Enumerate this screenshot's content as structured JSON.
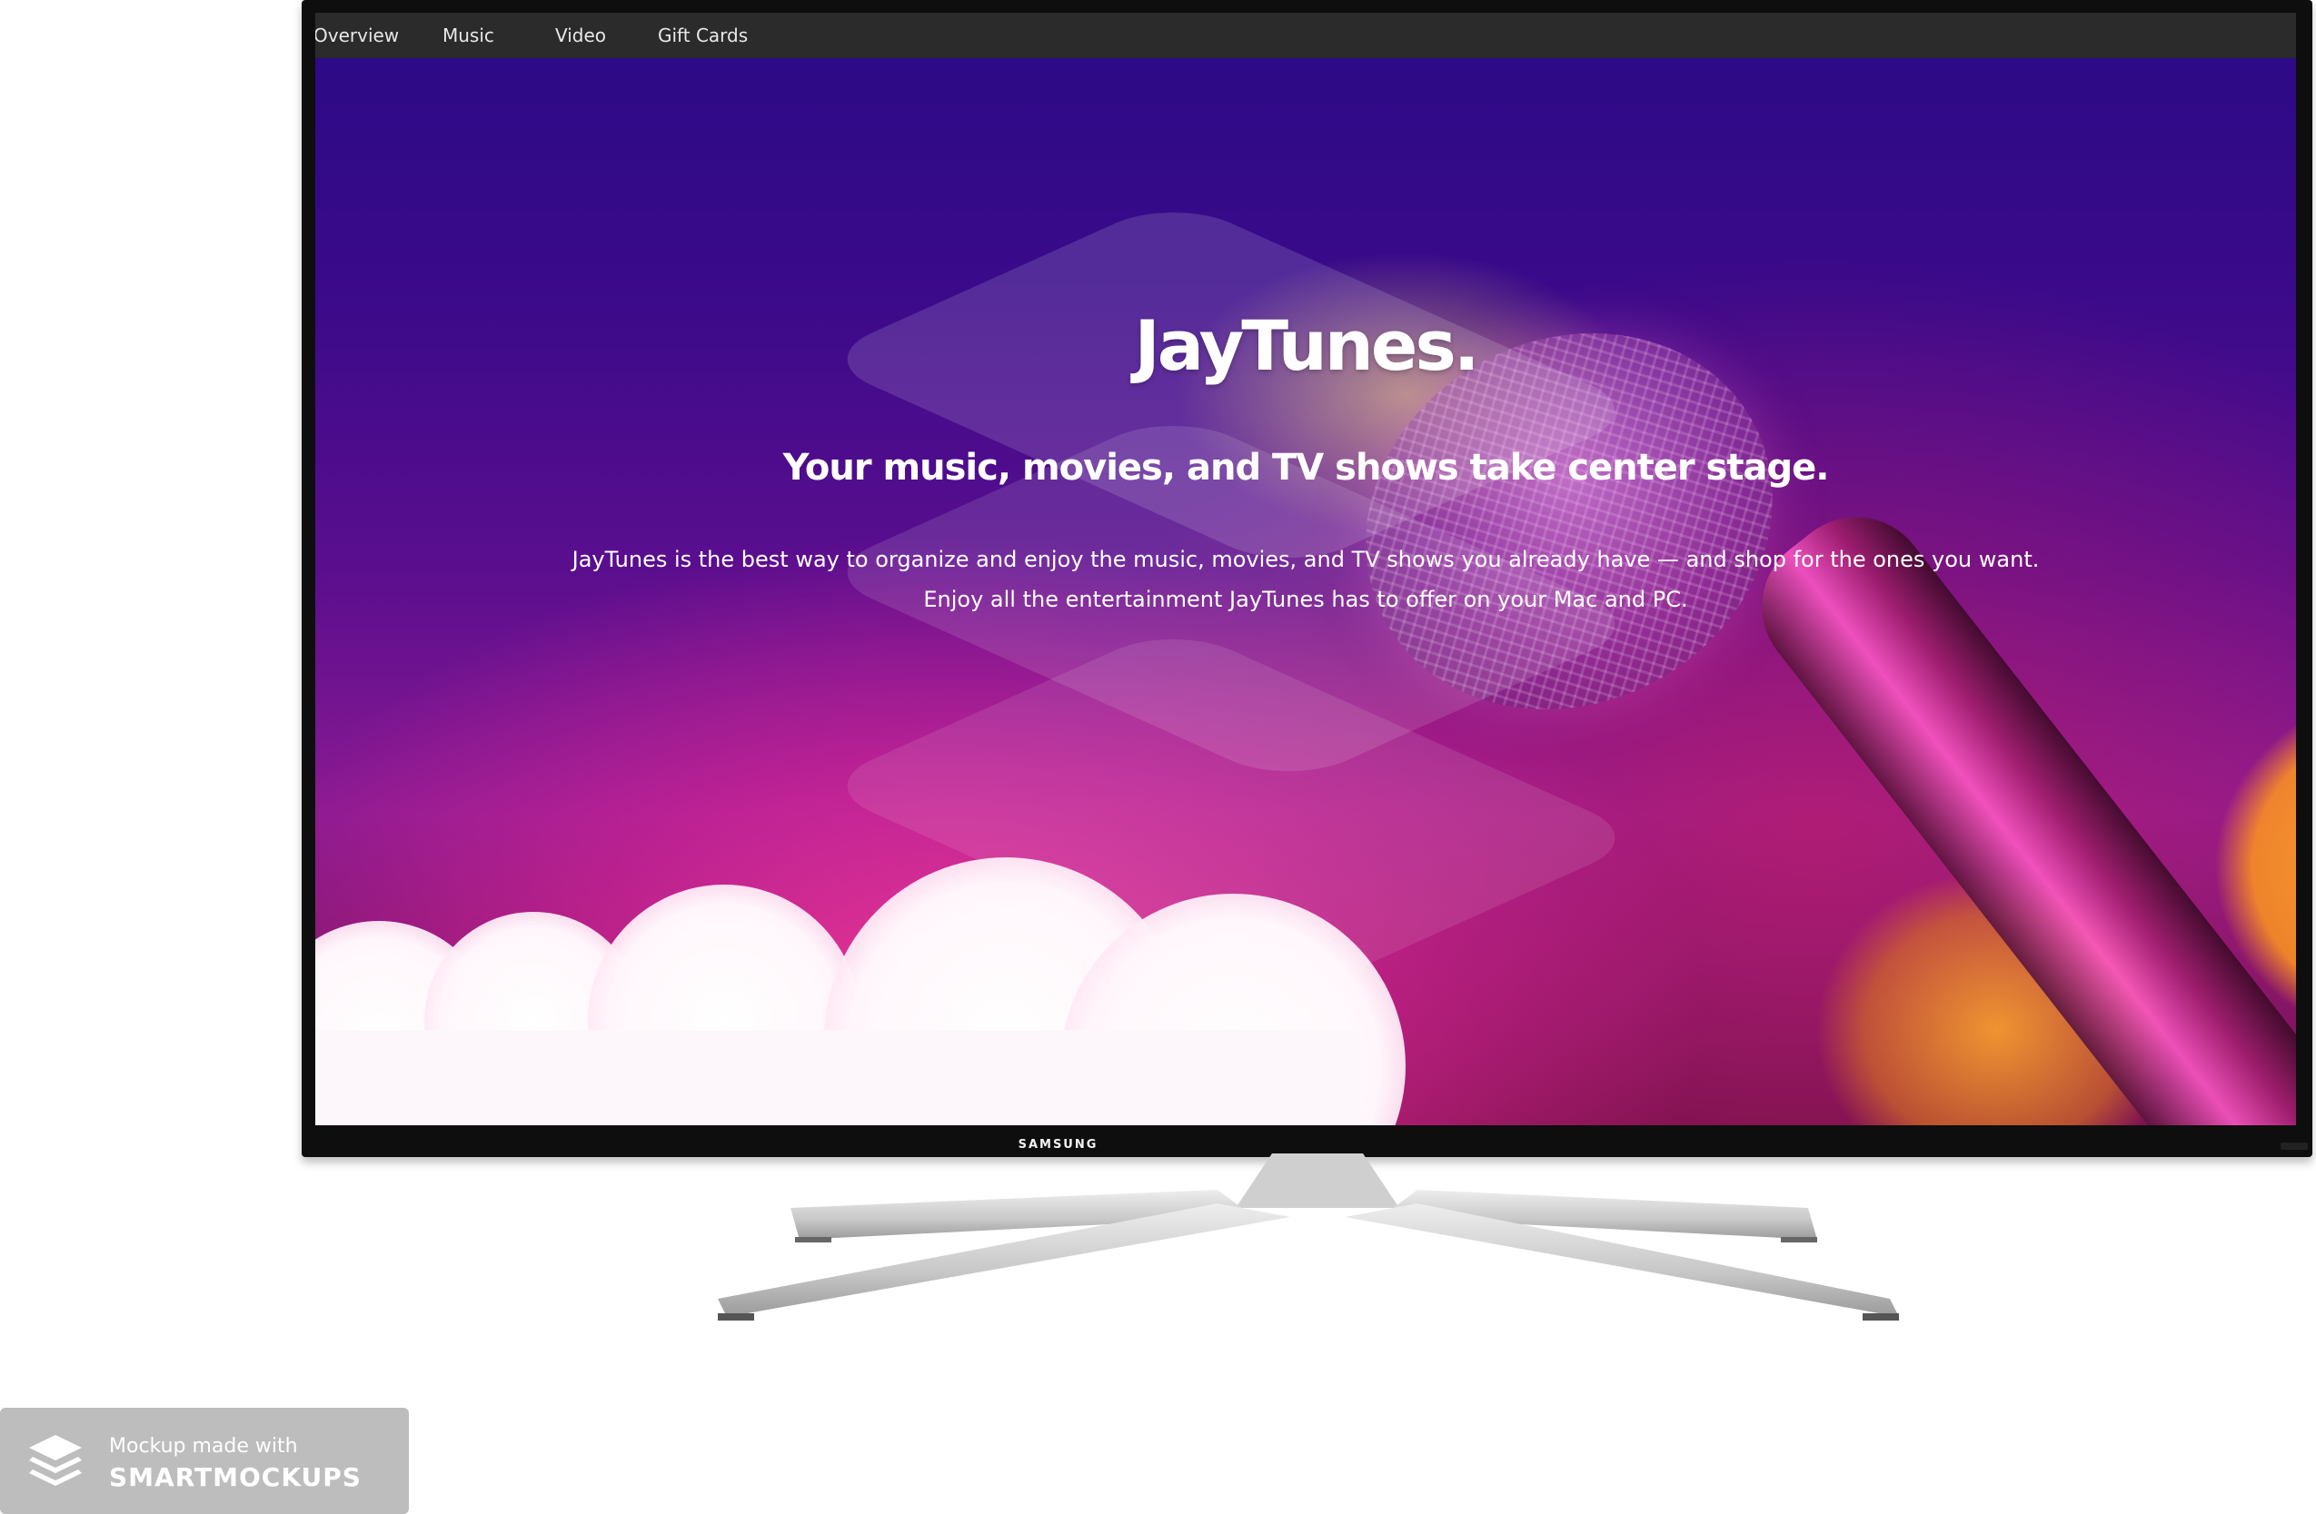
{
  "nav": {
    "items": [
      {
        "label": "Overview"
      },
      {
        "label": "Music"
      },
      {
        "label": "Video"
      },
      {
        "label": "Gift Cards"
      }
    ]
  },
  "hero": {
    "title": "JayTunes.",
    "subtitle": "Your music, movies, and TV shows take center stage.",
    "body_line1": "JayTunes is the best way to organize and enjoy the music, movies, and TV shows you already have — and shop for the ones you want.",
    "body_line2": "Enjoy all the entertainment JayTunes has to offer on your Mac and PC."
  },
  "tv": {
    "brand": "SAMSUNG"
  },
  "watermark": {
    "line1": "Mockup made with",
    "line2": "SMARTMOCKUPS"
  },
  "colors": {
    "nav_bg": "#2b2b2b",
    "screen_top": "#2a0a86",
    "screen_magenta": "#e02a98",
    "accent_orange": "#ffb228",
    "bezel": "#0e0e0e",
    "watermark_bg": "#bdbdbd"
  }
}
